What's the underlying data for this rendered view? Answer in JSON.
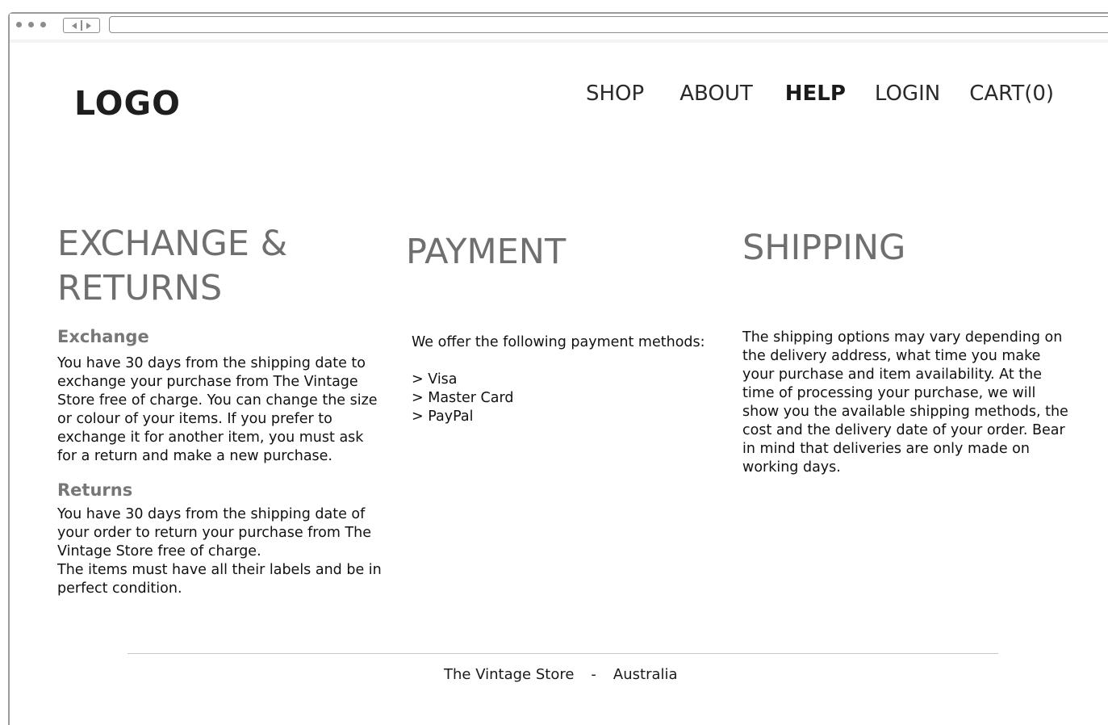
{
  "header": {
    "logo": "LOGO",
    "nav": {
      "shop": "SHOP",
      "about": "ABOUT",
      "help": "HELP",
      "login": "LOGIN",
      "cart": "CART(0)"
    }
  },
  "exchange_returns": {
    "title": "EXCHANGE & RETURNS",
    "exchange_heading": "Exchange",
    "exchange_text": "You have 30 days from the shipping date to exchange your purchase from The Vintage Store free of charge. You can change the size or colour of your items. If you prefer to exchange it for another item, you must ask for a return and make a new purchase.",
    "returns_heading": "Returns",
    "returns_text_1": "You have 30 days from the shipping date of your order to return your purchase from The Vintage Store free of charge.",
    "returns_text_2": "The items must have all their labels and be in perfect condition."
  },
  "payment": {
    "title": "PAYMENT",
    "intro": "We offer the following payment methods:",
    "methods": [
      "> Visa",
      "> Master Card",
      "> PayPal"
    ]
  },
  "shipping": {
    "title": "SHIPPING",
    "text": "The shipping options may vary depending on the delivery address, what time you make your purchase and item availability. At the time of processing your purchase, we will show you the available shipping methods, the cost and the delivery date of your order. Bear in mind that deliveries are only made on working days."
  },
  "footer": {
    "store_name": "The Vintage Store",
    "separator": "-",
    "country": "Australia"
  }
}
